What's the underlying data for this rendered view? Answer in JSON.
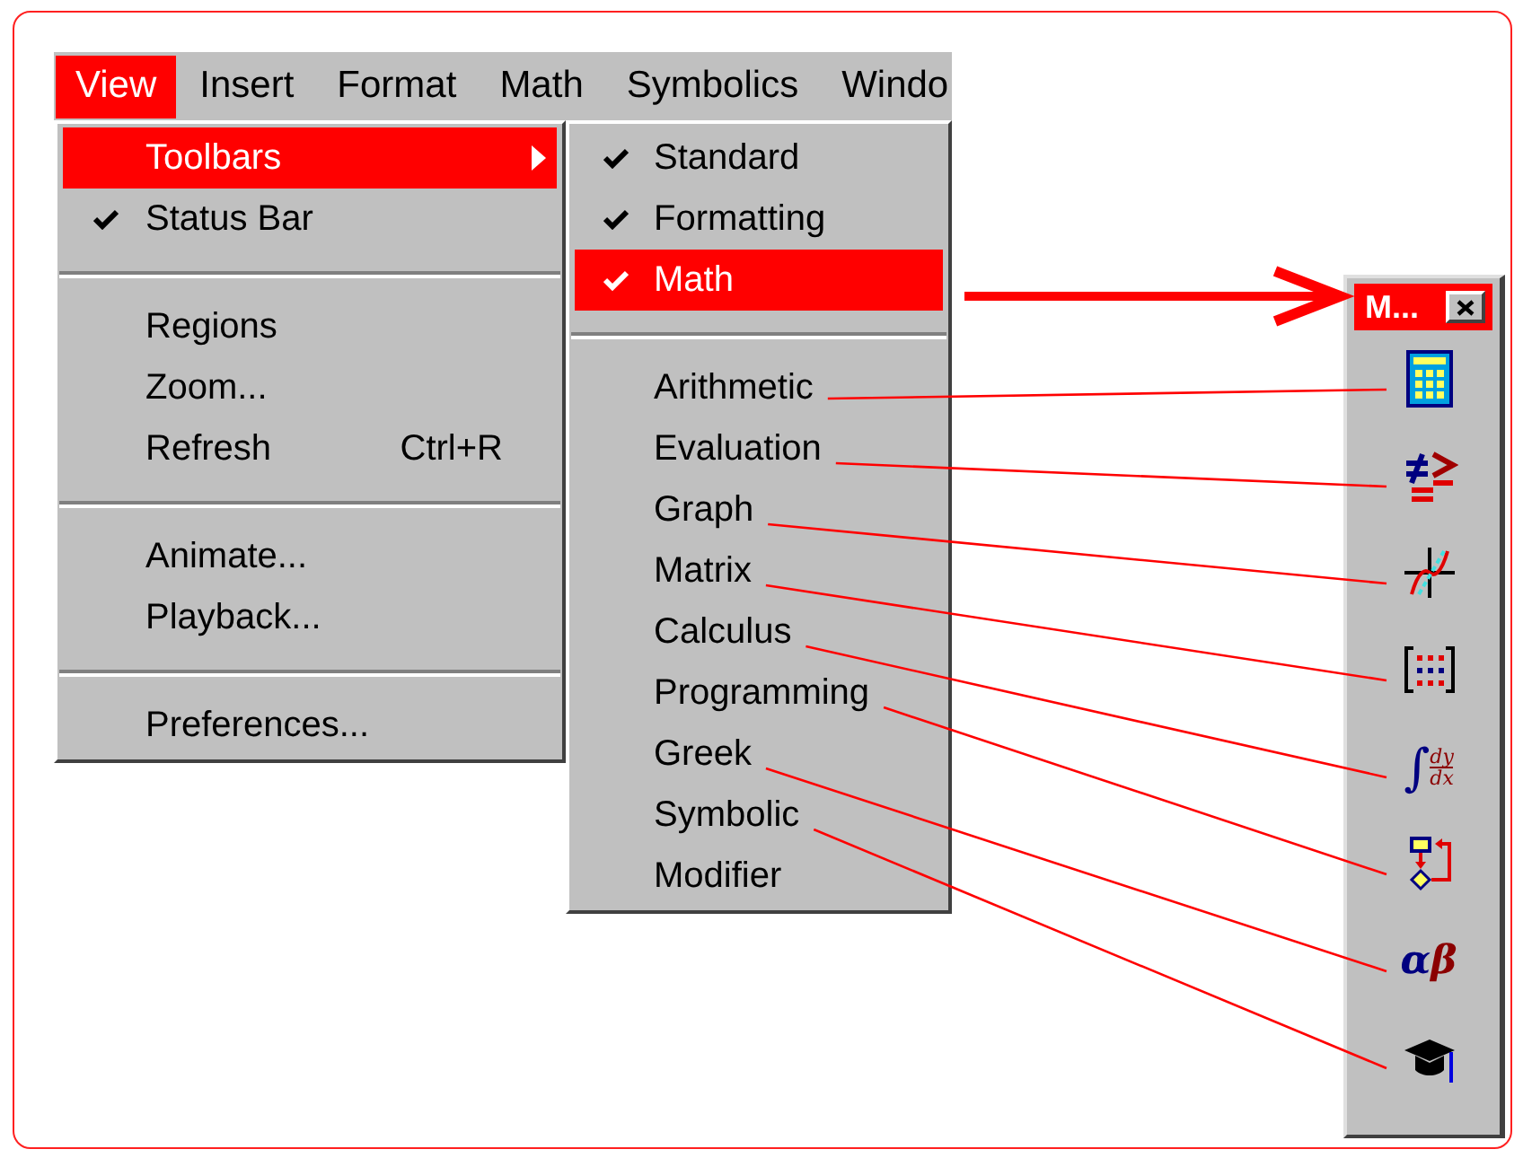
{
  "menubar": [
    {
      "label": "View",
      "selected": true
    },
    {
      "label": "Insert",
      "selected": false
    },
    {
      "label": "Format",
      "selected": false
    },
    {
      "label": "Math",
      "selected": false
    },
    {
      "label": "Symbolics",
      "selected": false
    },
    {
      "label": "Windo",
      "selected": false
    }
  ],
  "view_menu": [
    {
      "kind": "item",
      "label": "Toolbars",
      "checked": false,
      "selected": true,
      "submenu": true
    },
    {
      "kind": "item",
      "label": "Status Bar",
      "checked": true,
      "selected": false
    },
    {
      "kind": "separator"
    },
    {
      "kind": "item",
      "label": "Regions",
      "checked": false,
      "selected": false
    },
    {
      "kind": "item",
      "label": "Zoom...",
      "checked": false,
      "selected": false
    },
    {
      "kind": "item",
      "label": "Refresh",
      "checked": false,
      "selected": false,
      "shortcut": "Ctrl+R"
    },
    {
      "kind": "separator"
    },
    {
      "kind": "item",
      "label": "Animate...",
      "checked": false,
      "selected": false
    },
    {
      "kind": "item",
      "label": "Playback...",
      "checked": false,
      "selected": false
    },
    {
      "kind": "separator"
    },
    {
      "kind": "item",
      "label": "Preferences...",
      "checked": false,
      "selected": false
    }
  ],
  "toolbars_menu": [
    {
      "kind": "item",
      "label": "Standard",
      "checked": true,
      "selected": false
    },
    {
      "kind": "item",
      "label": "Formatting",
      "checked": true,
      "selected": false
    },
    {
      "kind": "item",
      "label": "Math",
      "checked": true,
      "selected": true
    },
    {
      "kind": "separator"
    },
    {
      "kind": "item",
      "label": "Arithmetic",
      "checked": false,
      "selected": false
    },
    {
      "kind": "item",
      "label": "Evaluation",
      "checked": false,
      "selected": false
    },
    {
      "kind": "item",
      "label": "Graph",
      "checked": false,
      "selected": false
    },
    {
      "kind": "item",
      "label": "Matrix",
      "checked": false,
      "selected": false
    },
    {
      "kind": "item",
      "label": "Calculus",
      "checked": false,
      "selected": false
    },
    {
      "kind": "item",
      "label": "Programming",
      "checked": false,
      "selected": false
    },
    {
      "kind": "item",
      "label": "Greek",
      "checked": false,
      "selected": false
    },
    {
      "kind": "item",
      "label": "Symbolic",
      "checked": false,
      "selected": false
    },
    {
      "kind": "item",
      "label": "Modifier",
      "checked": false,
      "selected": false
    }
  ],
  "math_toolbar": {
    "title": "M...",
    "buttons": [
      {
        "kind": "arithmetic"
      },
      {
        "kind": "evaluation"
      },
      {
        "kind": "graph"
      },
      {
        "kind": "matrix"
      },
      {
        "kind": "calculus",
        "glyph": "∫",
        "numerator": "dy",
        "denominator": "dx"
      },
      {
        "kind": "programming"
      },
      {
        "kind": "greek",
        "glyphs": [
          "α",
          "β"
        ]
      },
      {
        "kind": "symbolic"
      }
    ]
  }
}
